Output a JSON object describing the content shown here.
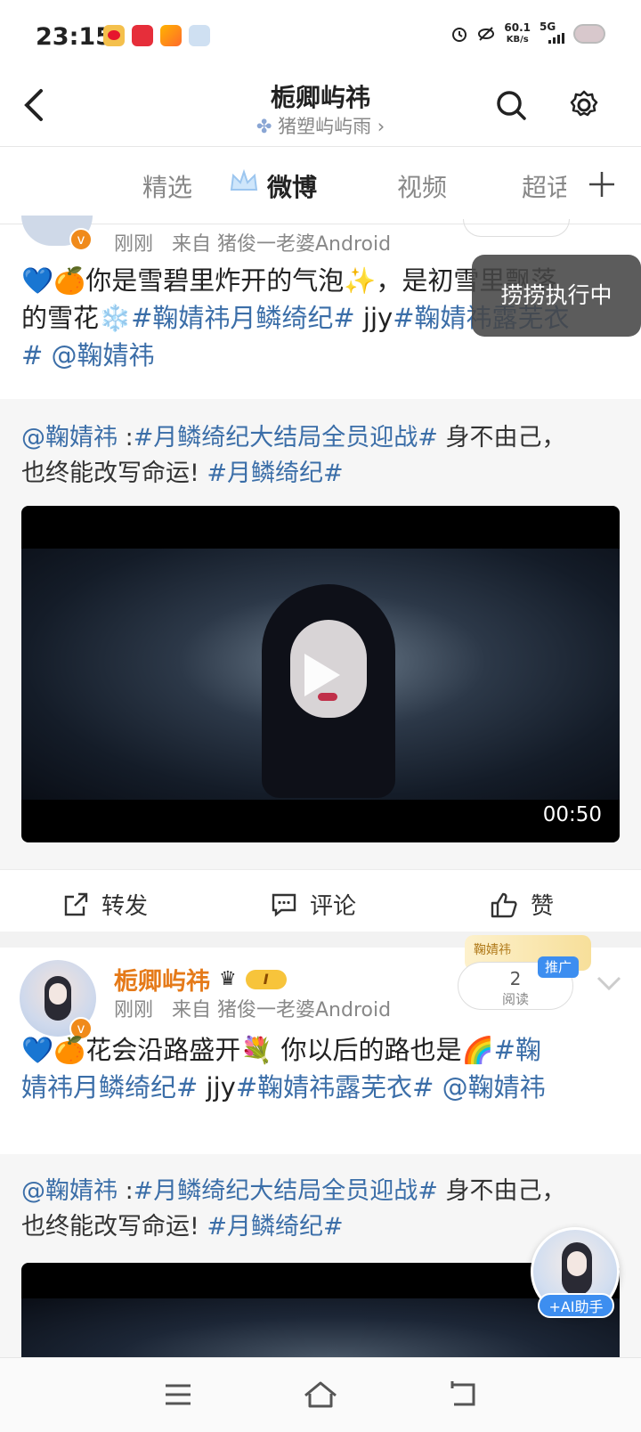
{
  "status_bar": {
    "time": "23:15",
    "net_speed": "60.1",
    "net_unit": "KB/s",
    "signal": "5G"
  },
  "header": {
    "title": "栀卿屿祎",
    "subtitle": "猪塑屿屿雨 ›"
  },
  "tabs": [
    {
      "label": "精选"
    },
    {
      "label": "微博"
    },
    {
      "label": "视频"
    },
    {
      "label": "超话"
    }
  ],
  "overlay": {
    "label": "捞捞执行中"
  },
  "post1": {
    "time": "刚刚",
    "source": "来自 猪俊一老婆Android",
    "text_plain_1": "💙🍊你是雪碧里炸开的气泡✨，是初雪里飘落",
    "text_plain_2": "的雪花❄️",
    "tag1": "#鞠婧祎月鳞绮纪#",
    "jjy": " jjy",
    "tag2": "#鞠婧祎露芜衣",
    "tag3": "#",
    "mention": " @鞠婧祎",
    "quote_mention": "@鞠婧祎",
    "quote_colon": " :",
    "quote_tag1": "#月鳞绮纪大结局全员迎战#",
    "quote_text1": " 身不由己，",
    "quote_text2": "也终能改写命运!",
    "quote_tag2": " #月鳞绮纪#",
    "video_duration": "00:50",
    "actions": {
      "repost": "转发",
      "comment": "评论",
      "like": "赞"
    }
  },
  "post2": {
    "name": "栀卿屿祎",
    "level_badge": "I",
    "time": "刚刚",
    "source": "来自 猪俊一老婆Android",
    "read_count": "2",
    "read_label": "阅读",
    "promote": "推广",
    "promo_label": "鞠婧祎",
    "text_plain": "💙🍊花会沿路盛开💐 你以后的路也是🌈",
    "tag1a": "#鞠",
    "tag1b": "婧祎月鳞绮纪#",
    "jjy": " jjy",
    "tag2": "#鞠婧祎露芜衣#",
    "mention": " @鞠婧祎",
    "quote_mention": "@鞠婧祎",
    "quote_colon": " :",
    "quote_tag1": "#月鳞绮纪大结局全员迎战#",
    "quote_text1": " 身不由己，",
    "quote_text2": "也终能改写命运!",
    "quote_tag2": " #月鳞绮纪#"
  },
  "ai_assistant": {
    "label": "+AI助手"
  },
  "colors": {
    "orange": "#e57a19",
    "link_blue": "#3b6ea8",
    "promo_blue": "#3d8ef0"
  }
}
